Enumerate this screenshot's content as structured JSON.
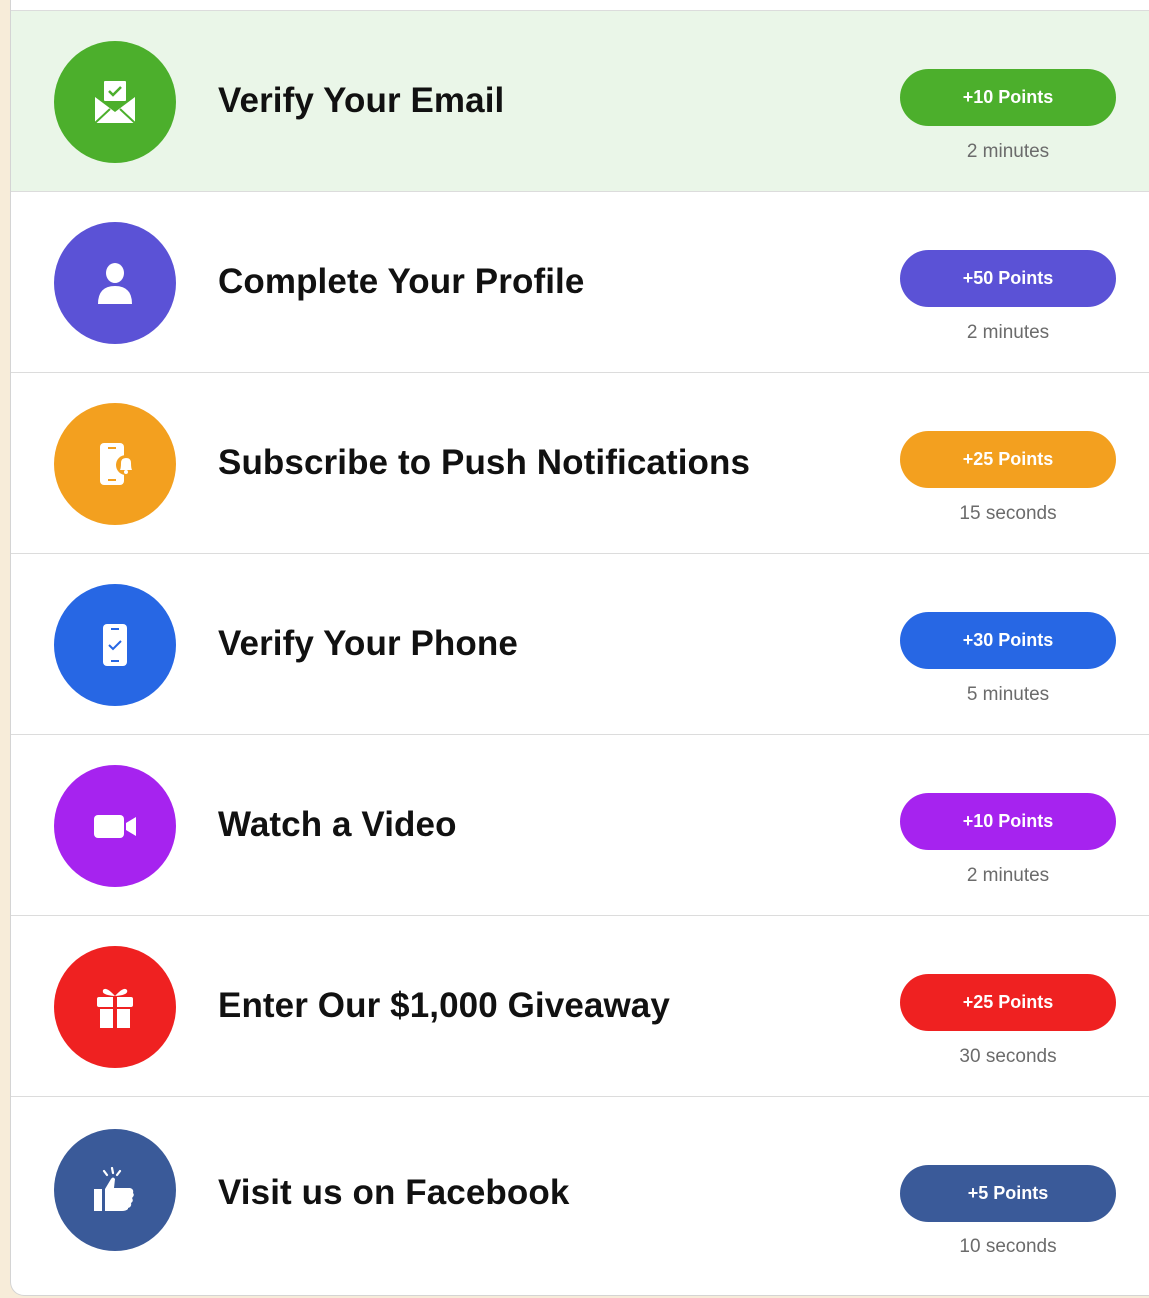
{
  "tasks": [
    {
      "title": "Verify Your Email",
      "points": "+10 Points",
      "duration": "2 minutes",
      "color": "#4caf2c",
      "icon": "email-check-icon",
      "highlighted": true
    },
    {
      "title": "Complete Your Profile",
      "points": "+50 Points",
      "duration": "2 minutes",
      "color": "#5b52d6",
      "icon": "user-icon",
      "highlighted": false
    },
    {
      "title": "Subscribe to Push Notifications",
      "points": "+25 Points",
      "duration": "15 seconds",
      "color": "#f3a01f",
      "icon": "phone-bell-icon",
      "highlighted": false
    },
    {
      "title": "Verify Your Phone",
      "points": "+30 Points",
      "duration": "5 minutes",
      "color": "#2767e4",
      "icon": "phone-check-icon",
      "highlighted": false
    },
    {
      "title": "Watch a Video",
      "points": "+10 Points",
      "duration": "2 minutes",
      "color": "#a623ef",
      "icon": "video-camera-icon",
      "highlighted": false
    },
    {
      "title": "Enter Our $1,000 Giveaway",
      "points": "+25 Points",
      "duration": "30 seconds",
      "color": "#ef2121",
      "icon": "gift-icon",
      "highlighted": false
    },
    {
      "title": "Visit us on Facebook",
      "points": "+5 Points",
      "duration": "10 seconds",
      "color": "#3a5a99",
      "icon": "thumbs-up-icon",
      "highlighted": false
    }
  ]
}
